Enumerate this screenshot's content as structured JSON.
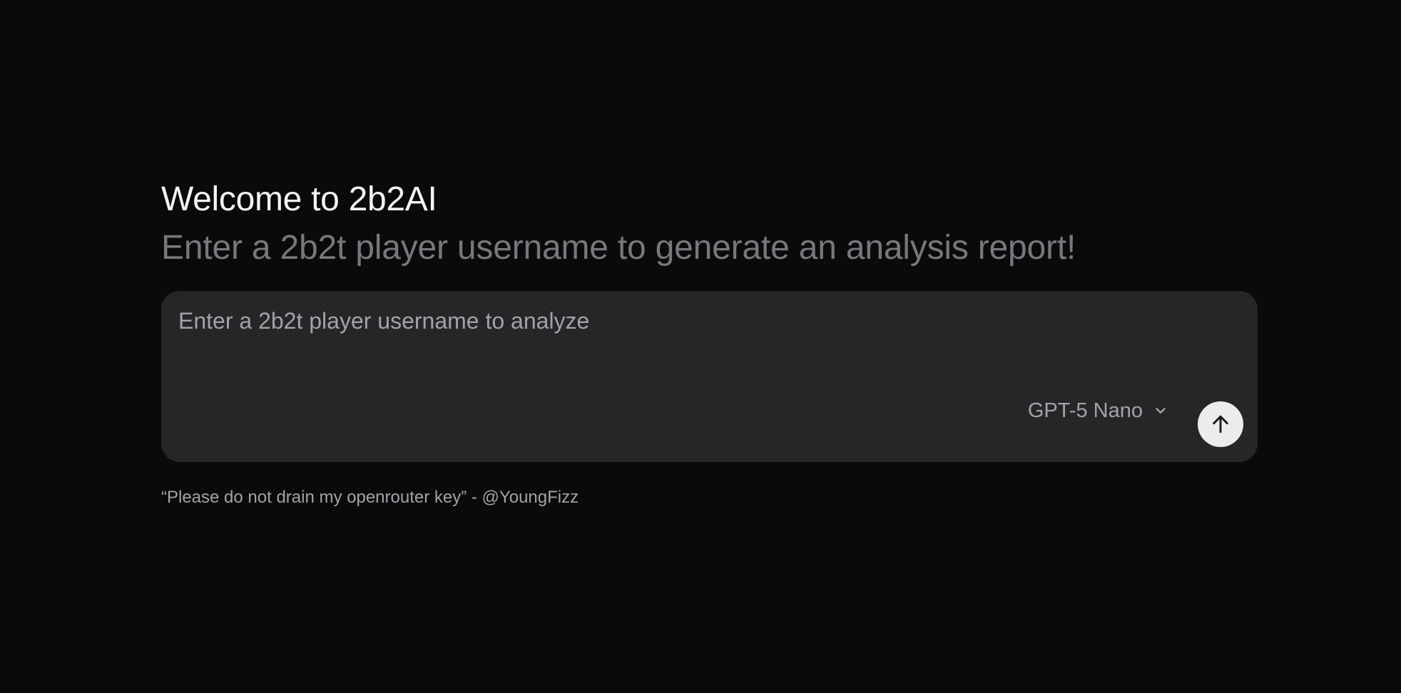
{
  "header": {
    "title": "Welcome to 2b2AI",
    "subtitle": "Enter a 2b2t player username to generate an analysis report!"
  },
  "composer": {
    "input_value": "",
    "placeholder": "Enter a 2b2t player username to analyze",
    "model_selected": "GPT-5 Nano",
    "model_icon": "chevron-down-icon",
    "send_icon": "arrow-up-icon"
  },
  "footer": {
    "quote": "“Please do not drain my openrouter key” - @YoungFizz"
  },
  "colors": {
    "background": "#0a0a0a",
    "composer_bg": "#262628",
    "title": "#f4f4f5",
    "subtitle": "#77777d",
    "muted_text": "#a2a2a8",
    "send_button_bg": "#ececec"
  }
}
